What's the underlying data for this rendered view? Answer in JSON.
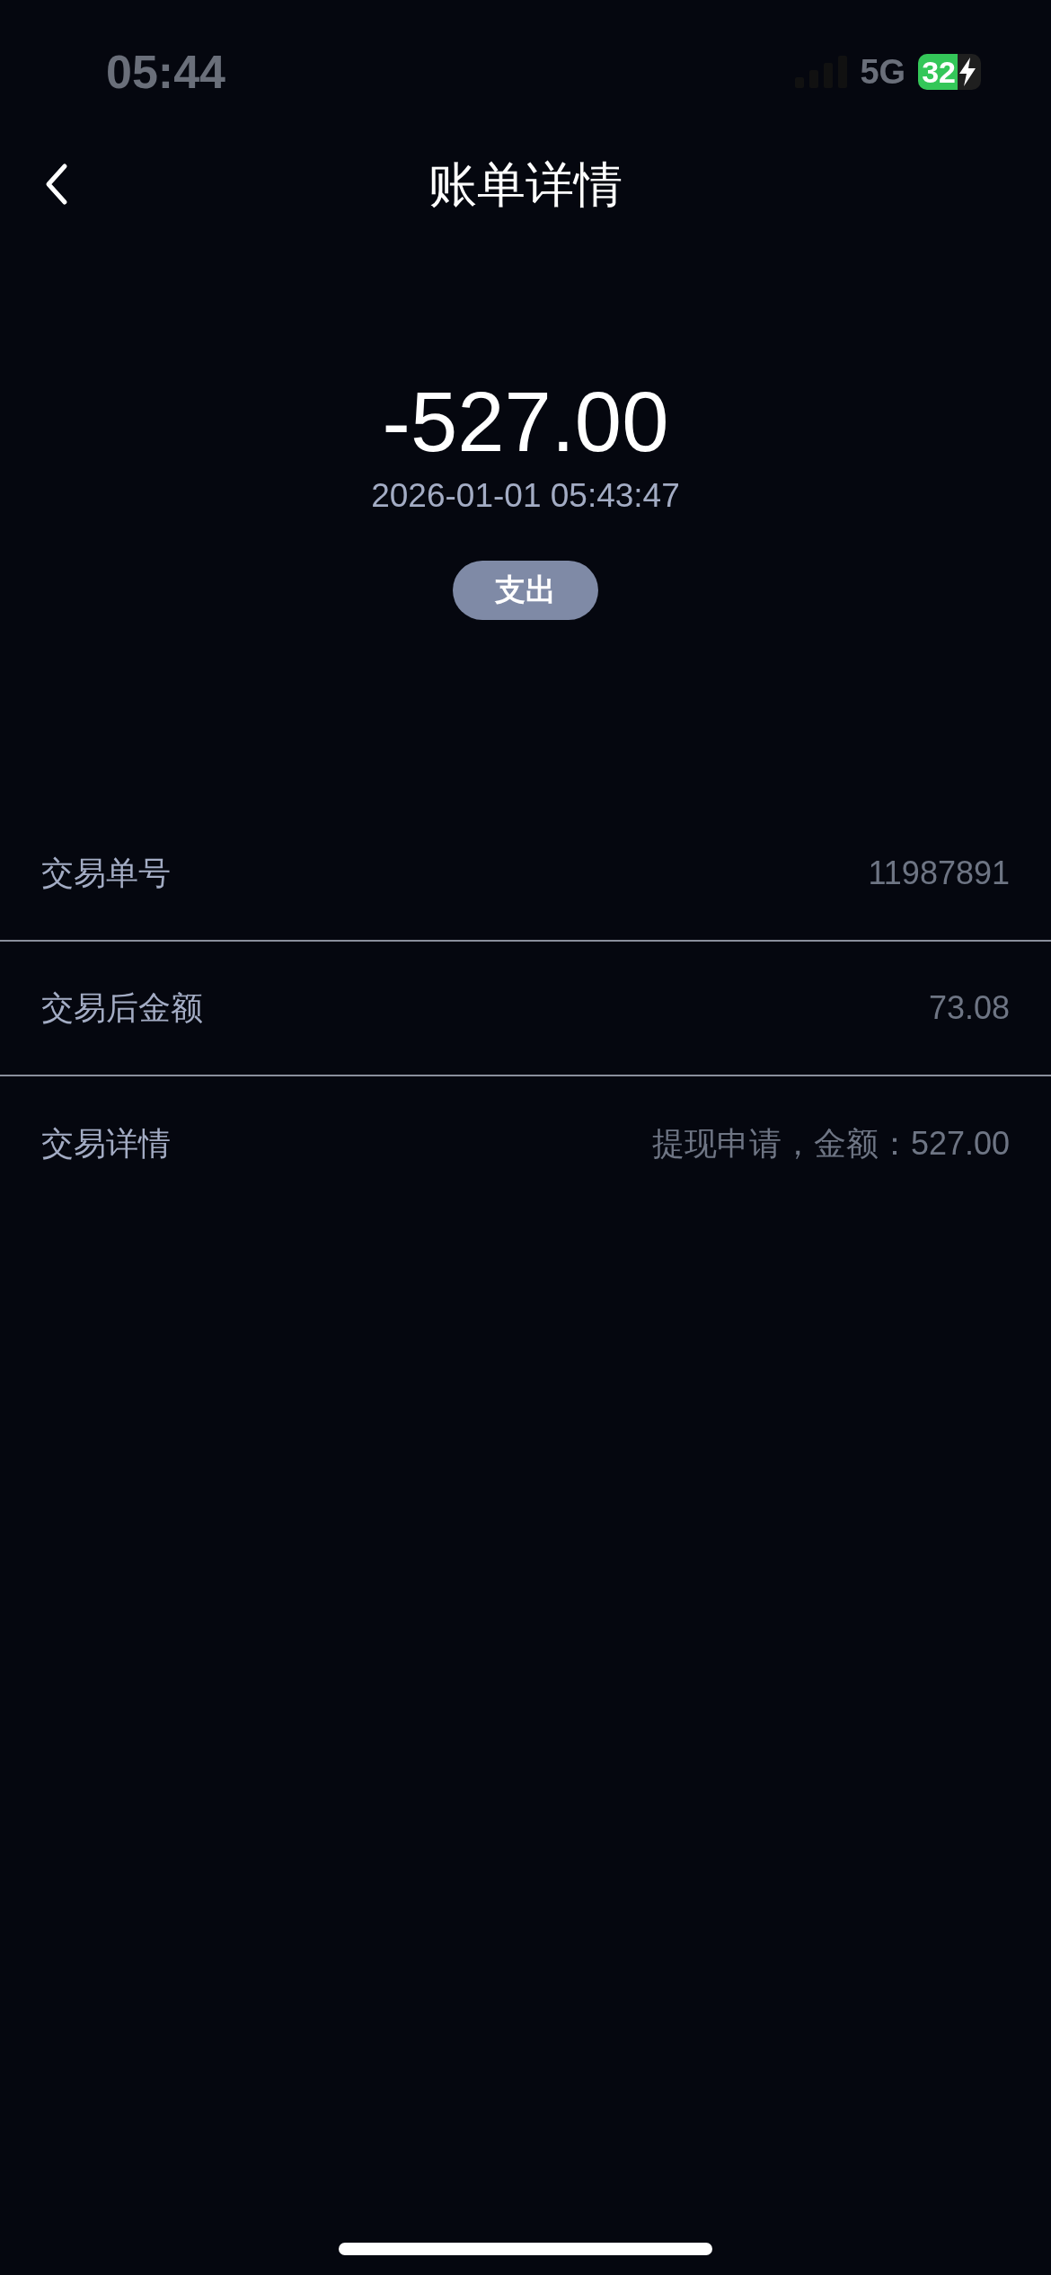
{
  "status_bar": {
    "time": "05:44",
    "network": "5G",
    "battery": "32"
  },
  "header": {
    "title": "账单详情"
  },
  "summary": {
    "amount": "-527.00",
    "datetime": "2026-01-01 05:43:47",
    "type_badge": "支出"
  },
  "details": [
    {
      "label": "交易单号",
      "value": "11987891"
    },
    {
      "label": "交易后金额",
      "value": "73.08"
    },
    {
      "label": "交易详情",
      "value": "提现申请，金额：527.00"
    }
  ]
}
